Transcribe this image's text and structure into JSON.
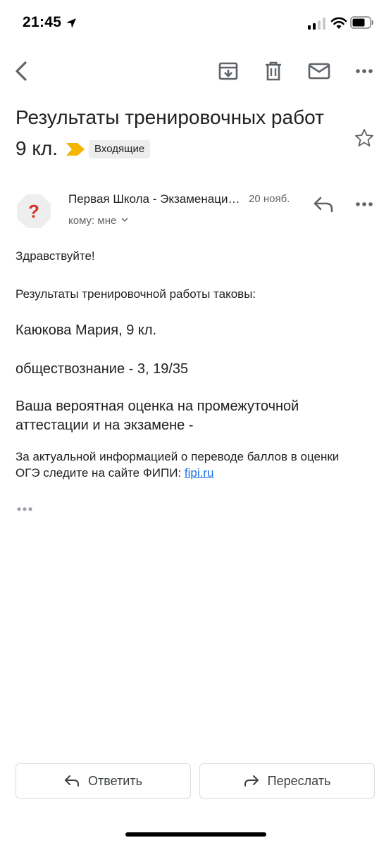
{
  "status": {
    "time": "21:45"
  },
  "icons": {
    "back": "back-arrow-icon",
    "archive": "archive-icon",
    "delete": "trash-icon",
    "mark_unread": "mail-icon",
    "more": "more-horizontal-icon",
    "star": "star-outline-icon",
    "reply": "reply-icon"
  },
  "email": {
    "subject": "Результаты тренировочных работ 9 кл.",
    "label": "Входящие",
    "label_color": "#f4b400",
    "sender": {
      "avatar_glyph": "?",
      "avatar_color": "#d93025",
      "name": "Первая Школа - Экзаменационный",
      "date": "20 нояб.",
      "recipient": "кому: мне"
    },
    "body": {
      "greeting": "Здравствуйте!",
      "intro": "Результаты тренировочной работы таковы:",
      "student": "Каюкова Мария, 9 кл.",
      "result": "обществознание - 3, 19/35",
      "estimate": "Ваша вероятная оценка на промежуточной аттестации и на экзамене -",
      "info": "За актуальной информацией о переводе баллов в оценки ОГЭ следите на сайте ФИПИ: ",
      "link": "fipi.ru"
    }
  },
  "actions": {
    "reply": "Ответить",
    "forward": "Переслать"
  },
  "colors": {
    "link": "#1a73e8",
    "icon": "#5f6368"
  }
}
